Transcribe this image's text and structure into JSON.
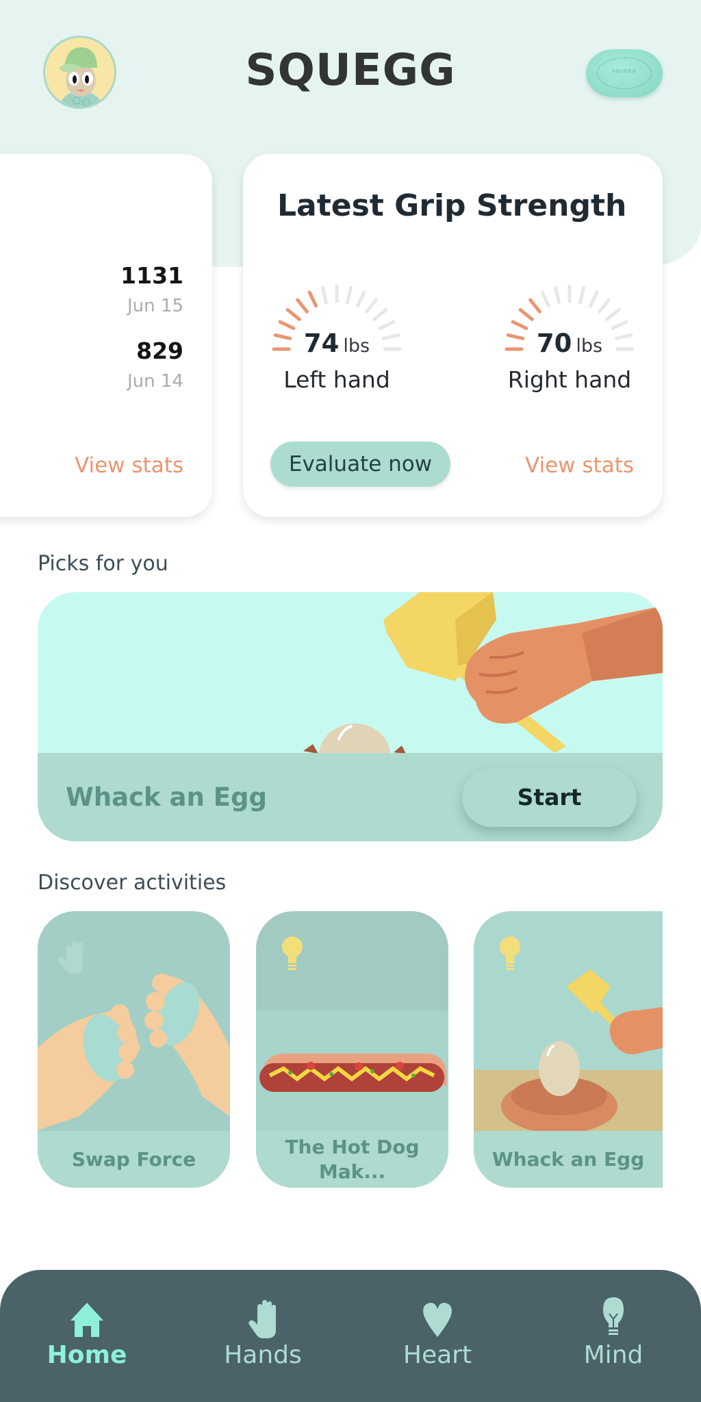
{
  "header": {
    "logo": "SQUEGG",
    "avatar_icon": "kid-avatar-icon",
    "device_icon": "squegg-device-icon",
    "device_mark": "SQUEGG"
  },
  "colors": {
    "accent_orange": "#e9966f",
    "mint": "#aedad0",
    "nav_bg": "#4a6268",
    "nav_active": "#8ef0d8",
    "nav_inactive": "#aedcd3"
  },
  "stats_card": {
    "entries": [
      {
        "value": "1131",
        "date": "Jun 15"
      },
      {
        "value": "829",
        "date": "Jun 14"
      }
    ],
    "view_stats": "View stats"
  },
  "grip_card": {
    "title": "Latest Grip Strength",
    "gauges": [
      {
        "value": "74",
        "unit": "lbs",
        "label": "Left hand",
        "filled_ticks": 6,
        "total_ticks": 15
      },
      {
        "value": "70",
        "unit": "lbs",
        "label": "Right hand",
        "filled_ticks": 5,
        "total_ticks": 15
      }
    ],
    "evaluate_button": "Evaluate now",
    "view_stats": "View stats"
  },
  "picks": {
    "section_title": "Picks for you",
    "title": "Whack an Egg",
    "start_button": "Start"
  },
  "discover": {
    "section_title": "Discover activities",
    "activities": [
      {
        "label": "Swap Force",
        "icon": "hand-icon"
      },
      {
        "label": "The Hot Dog Mak...",
        "icon": "lightbulb-icon"
      },
      {
        "label": "Whack an Egg",
        "icon": "lightbulb-icon"
      }
    ]
  },
  "nav": {
    "items": [
      {
        "label": "Home",
        "icon": "home-icon",
        "active": true
      },
      {
        "label": "Hands",
        "icon": "hand-icon",
        "active": false
      },
      {
        "label": "Heart",
        "icon": "heart-icon",
        "active": false
      },
      {
        "label": "Mind",
        "icon": "lightbulb-icon",
        "active": false
      }
    ]
  }
}
